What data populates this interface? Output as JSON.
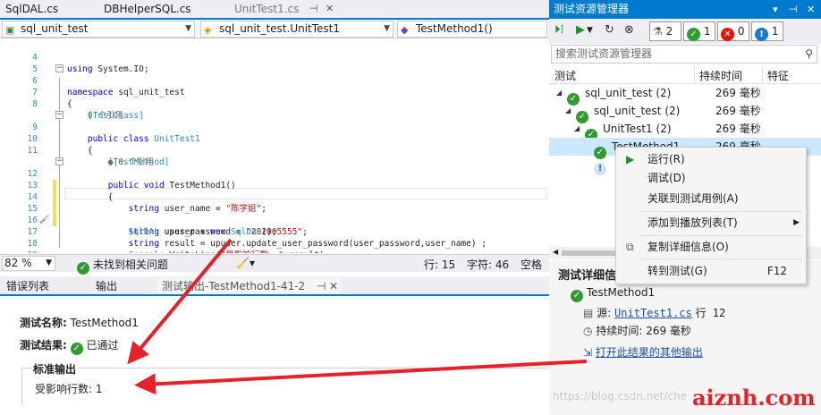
{
  "doc_tabs": [
    {
      "label": "SqlDAL.cs",
      "state": "inactive"
    },
    {
      "label": "DBHelperSQL.cs",
      "state": "inactive"
    },
    {
      "label": "UnitTest1.cs",
      "state": "preview"
    }
  ],
  "nav_bar": {
    "project": "sql_unit_test",
    "class": "sql_unit_test.UnitTest1",
    "member": "TestMethod1()"
  },
  "editor": {
    "lines": [
      {
        "n": "4",
        "code": "using System.IO;"
      },
      {
        "n": "5",
        "code": ""
      },
      {
        "n": "6",
        "code": "namespace sql_unit_test"
      },
      {
        "n": "7",
        "code": "{"
      },
      {
        "n": "8",
        "code": "    [TestClass]"
      },
      {
        "n": "",
        "code": "    0 个引用"
      },
      {
        "n": "9",
        "code": "    public class UnitTest1"
      },
      {
        "n": "10",
        "code": "    {"
      },
      {
        "n": "11",
        "code": "        [TestMethod]"
      },
      {
        "n": "",
        "code": "        ●|0 个引用"
      },
      {
        "n": "12",
        "code": "        public void TestMethod1()"
      },
      {
        "n": "13",
        "code": "        {"
      },
      {
        "n": "14",
        "code": "            string user_name = \"陈学姐\";"
      },
      {
        "n": "15",
        "code": "            string user_password = \"202005555\";"
      },
      {
        "n": "16",
        "code": "            SqlDAL upuser = new SqlDAL();"
      },
      {
        "n": "17",
        "code": "            string result = upuser.update_user_password(user_password,user_name) ;"
      },
      {
        "n": "18",
        "code": "            Console.WriteLine(\"受影响行数: \"+result);"
      },
      {
        "n": "19",
        "code": "        }"
      }
    ]
  },
  "status": {
    "zoom": "82 %",
    "issues": "未找到相关问题",
    "row": "行: 15",
    "char": "字符: 46",
    "space": "空格"
  },
  "bottom_tabs": [
    {
      "label": "错误列表"
    },
    {
      "label": "输出"
    },
    {
      "label": "测试输出-TestMethod1-41-2"
    }
  ],
  "test_output": {
    "name_label": "测试名称:",
    "name_value": "TestMethod1",
    "result_label": "测试结果:",
    "result_value": "已通过",
    "std_output_label": "标准输出",
    "std_output_value": "受影响行数: 1"
  },
  "test_explorer": {
    "title": "测试资源管理器",
    "counts": {
      "total": "2",
      "passed": "1",
      "failed": "0",
      "not_run": "1"
    },
    "search_placeholder": "搜索测试资源管理器",
    "columns": {
      "test": "测试",
      "duration": "持续时间",
      "traits": "特征"
    },
    "tree": [
      {
        "label": "sql_unit_test (2)",
        "duration": "269 毫秒",
        "status": "passed"
      },
      {
        "label": "sql_unit_test (2)",
        "duration": "269 毫秒",
        "status": "passed"
      },
      {
        "label": "UnitTest1 (2)",
        "duration": "269 毫秒",
        "status": "passed"
      },
      {
        "label": "TestMethod1",
        "duration": "269 毫秒",
        "status": "passed"
      }
    ],
    "detail": {
      "header": "测试详细信",
      "test_name": "TestMethod1",
      "source_label": "源:",
      "source_file": "UnitTest1.cs",
      "source_line": "行 12",
      "duration_label": "持续时间:",
      "duration_value": "269 毫秒",
      "open_output_link": "打开此结果的其他输出"
    }
  },
  "context_menu": {
    "items": [
      {
        "label": "运行(R)",
        "shortcut": ""
      },
      {
        "label": "调试(D)",
        "shortcut": ""
      },
      {
        "label": "关联到测试用例(A)",
        "shortcut": ""
      },
      {
        "label": "添加到播放列表(T)",
        "shortcut": ""
      },
      {
        "label": "复制详细信息(O)",
        "shortcut": ""
      },
      {
        "label": "转到测试(G)",
        "shortcut": "F12"
      }
    ]
  },
  "watermark": {
    "url": "https://blog.csdn.net/che",
    "logo": "aiznh.com"
  },
  "colors": {
    "accent": "#007acc",
    "pass": "#339933",
    "fail": "#e51400",
    "arrow": "#e8202a"
  }
}
